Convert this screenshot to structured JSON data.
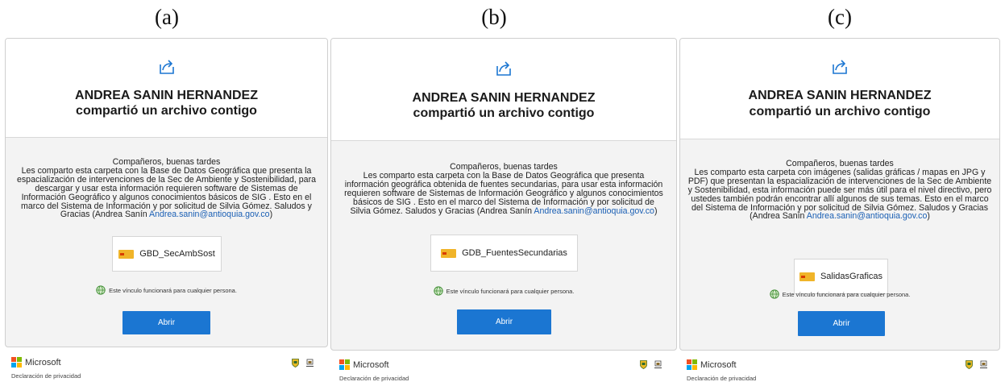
{
  "panels": [
    {
      "label": "(a)",
      "sender": "ANDREA SANIN HERNANDEZ",
      "action": "compartió un archivo contigo",
      "greeting": "Compañeros, buenas tardes",
      "message": "Les comparto esta carpeta con la Base de Datos Geográfica que presenta la espacialización de intervenciones de la Sec de Ambiente y Sostenibilidad, para descargar y usar esta información requieren software de Sistemas de Información Geográfico y algunos conocimientos básicos de SIG . Esto en el marco del Sistema de Información y por solicitud de Silvia Gómez. Saludos y Gracias (Andrea Sanín",
      "email": "Andrea.sanin@antioquia.gov.co",
      "closing": ")",
      "file_name": "GBD_SecAmbSost",
      "link_note": "Este vínculo funcionará para cualquier persona.",
      "button": "Abrir",
      "brand": "Microsoft",
      "privacy": "Declaración de privacidad"
    },
    {
      "label": "(b)",
      "sender": "ANDREA SANIN HERNANDEZ",
      "action": "compartió un archivo contigo",
      "greeting": "Compañeros, buenas tardes",
      "message": "Les comparto esta carpeta con la Base de Datos Geográfica que presenta información geográfica obtenida de fuentes secundarias, para usar esta información requieren software de Sistemas de Información Geográfico y algunos conocimientos básicos de SIG . Esto en el marco del Sistema de Información y por solicitud de Silvia Gómez. Saludos y Gracias (Andrea Sanín",
      "email": "Andrea.sanin@antioquia.gov.co",
      "closing": ")",
      "file_name": "GDB_FuentesSecundarias",
      "link_note": "Este vínculo funcionará para cualquier persona.",
      "button": "Abrir",
      "brand": "Microsoft",
      "privacy": "Declaración de privacidad"
    },
    {
      "label": "(c)",
      "sender": "ANDREA SANIN HERNANDEZ",
      "action": "compartió un archivo contigo",
      "greeting": "Compañeros, buenas tardes",
      "message": "Les comparto esta carpeta con imágenes (salidas gráficas / mapas en JPG y PDF) que presentan la espacialización de intervenciones de la Sec de Ambiente y Sostenibilidad, esta información puede ser más útil para el nivel directivo, pero ustedes también podrán encontrar allí algunos de sus temas. Esto en el marco del Sistema de Información y por solicitud de Silvia Gómez. Saludos y Gracias (Andrea Sanín",
      "email": "Andrea.sanin@antioquia.gov.co",
      "closing": ")",
      "file_name": "SalidasGraficas",
      "link_note": "Este vínculo funcionará para cualquier persona.",
      "button": "Abrir",
      "brand": "Microsoft",
      "privacy": "Declaración de privacidad"
    }
  ],
  "colors": {
    "accent": "#1b76d2",
    "link": "#1a5fb4",
    "folder": "#f0b429",
    "ms_red": "#f25022",
    "ms_green": "#7fba00",
    "ms_blue": "#00a4ef",
    "ms_yellow": "#ffb900"
  },
  "icons": [
    "share-icon",
    "folder-icon",
    "globe-icon",
    "microsoft-logo",
    "crest-icon"
  ]
}
